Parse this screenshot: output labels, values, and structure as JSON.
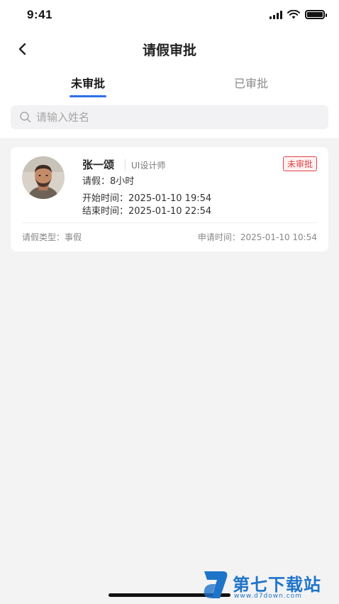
{
  "status_bar": {
    "time": "9:41"
  },
  "nav": {
    "title": "请假审批"
  },
  "tabs": [
    {
      "label": "未审批",
      "active": true
    },
    {
      "label": "已审批",
      "active": false
    }
  ],
  "search": {
    "placeholder": "请输入姓名",
    "value": ""
  },
  "requests": [
    {
      "name": "张一颂",
      "role": "UI设计师",
      "status": "未审批",
      "leave": "请假：8小时",
      "start": "开始时间：2025-01-10 19:54",
      "end": "结束时间：2025-01-10 22:54",
      "type": "请假类型：事假",
      "applied": "申请时间：2025-01-10 10:54"
    }
  ],
  "colors": {
    "accent": "#2f6fe8",
    "status_red": "#e0444a",
    "background": "#f3f3f4"
  },
  "watermark": {
    "text": "第七下载站",
    "url": "www.d7down.com"
  }
}
